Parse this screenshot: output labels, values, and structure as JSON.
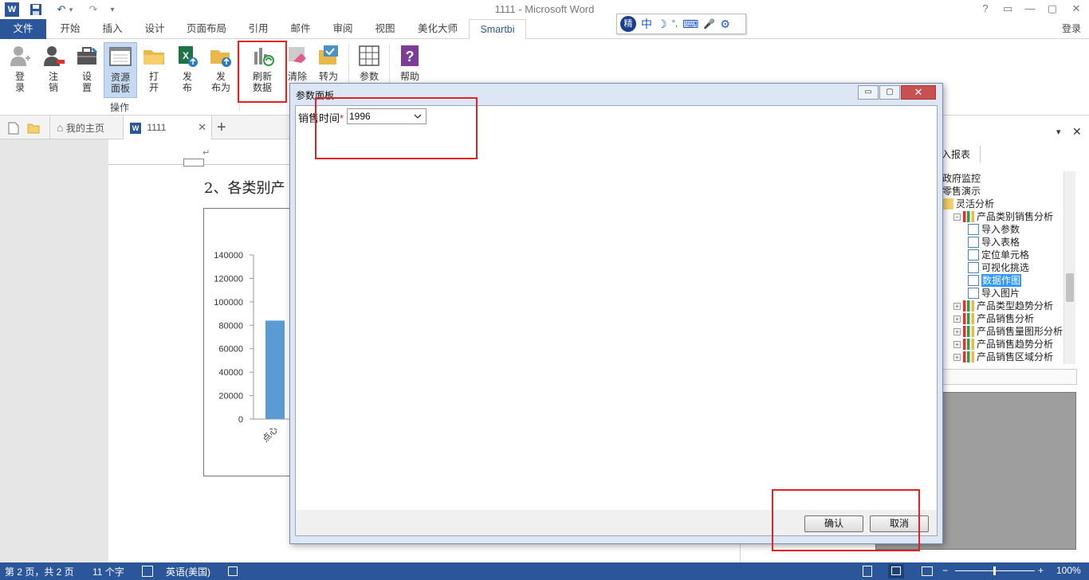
{
  "window": {
    "title": "1111 - Microsoft Word",
    "help": "?",
    "controls": [
      "▭",
      "—",
      "▢",
      "✕"
    ]
  },
  "quick_access": {
    "undo": "↶",
    "redo": "↷",
    "more": "▾"
  },
  "ime": {
    "logo": "精",
    "items": [
      "中",
      "☽",
      "°,",
      "⌨",
      "🎤",
      "⚙"
    ]
  },
  "ribbon_tabs": {
    "file": "文件",
    "items": [
      "开始",
      "插入",
      "设计",
      "页面布局",
      "引用",
      "邮件",
      "审阅",
      "视图",
      "美化大师",
      "Smartbi"
    ],
    "login": "登录"
  },
  "ribbon": {
    "buttons": [
      {
        "label1": "登",
        "label2": "录"
      },
      {
        "label1": "注",
        "label2": "销"
      },
      {
        "label1": "设",
        "label2": "置"
      },
      {
        "label1": "资源",
        "label2": "面板"
      },
      {
        "label1": "打",
        "label2": "开"
      },
      {
        "label1": "发",
        "label2": "布"
      },
      {
        "label1": "发",
        "label2": "布为"
      },
      {
        "label1": "刷新",
        "label2": "数据"
      },
      {
        "label1": "清除",
        "label2": ""
      },
      {
        "label1": "转为",
        "label2": ""
      },
      {
        "label1": "参数",
        "label2": ""
      },
      {
        "label1": "帮助",
        "label2": ""
      }
    ],
    "group_label": "操作"
  },
  "doc_tabs": {
    "home": "我的主页",
    "doc": "1111",
    "close": "✕",
    "add": "+"
  },
  "document": {
    "heading": "2、各类别产",
    "paragraph_mark": "↵"
  },
  "chart_data": {
    "type": "bar",
    "categories": [
      "点心"
    ],
    "values": [
      84000
    ],
    "ylim": [
      0,
      140000
    ],
    "yticks": [
      "140000",
      "120000",
      "100000",
      "80000",
      "60000",
      "40000",
      "20000",
      "0"
    ],
    "bar_color": "#5b9bd5"
  },
  "right_pane": {
    "tab_label": "入报表",
    "down": "▾",
    "close": "✕",
    "tree": [
      {
        "label": "政府监控",
        "level": 0
      },
      {
        "label": "零售演示",
        "level": 0
      },
      {
        "label": "灵活分析",
        "level": 1
      },
      {
        "label": "产品类别销售分析",
        "level": 2,
        "expander": "−"
      },
      {
        "label": "导入参数",
        "level": 3
      },
      {
        "label": "导入表格",
        "level": 3
      },
      {
        "label": "定位单元格",
        "level": 3
      },
      {
        "label": "可视化挑选",
        "level": 3
      },
      {
        "label": "数据作图",
        "level": 3,
        "selected": true
      },
      {
        "label": "导入图片",
        "level": 3
      },
      {
        "label": "产品类型趋势分析",
        "level": 2,
        "expander": "+"
      },
      {
        "label": "产品销售分析",
        "level": 2,
        "expander": "+"
      },
      {
        "label": "产品销售量图形分析",
        "level": 2,
        "expander": "+"
      },
      {
        "label": "产品销售趋势分析",
        "level": 2,
        "expander": "+"
      },
      {
        "label": "产品销售区域分析",
        "level": 2,
        "expander": "+"
      }
    ]
  },
  "dialog": {
    "title": "参数面板",
    "controls": [
      "▭",
      "▢",
      "✕"
    ],
    "param_label": "销售时间",
    "required_mark": "*",
    "param_value": "1996",
    "confirm": "确认",
    "cancel": "取消"
  },
  "status_bar": {
    "page": "第 2 页，共 2 页",
    "words": "11 个字",
    "language": "英语(美国)",
    "zoom_minus": "−",
    "zoom_plus": "+",
    "zoom": "100%"
  }
}
